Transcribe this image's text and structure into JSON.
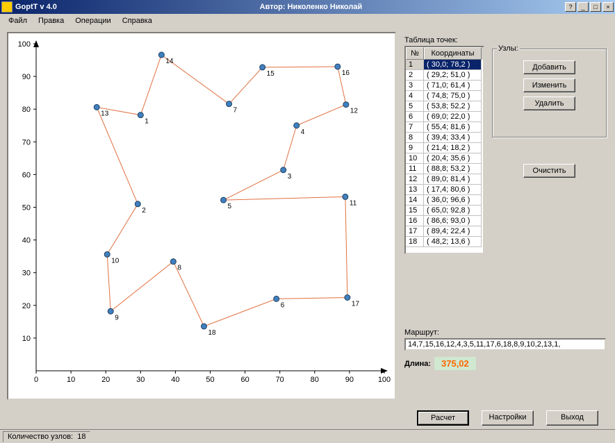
{
  "window": {
    "title_left": "GoptT v 4.0",
    "title_center": "Автор: Николенко Николай"
  },
  "menu": {
    "file": "Файл",
    "edit": "Правка",
    "ops": "Операции",
    "help": "Справка"
  },
  "labels": {
    "table": "Таблица точек:",
    "nodes_group": "Узлы:",
    "route": "Маршрут:",
    "length": "Длина:"
  },
  "table": {
    "col_n": "№",
    "col_coord": "Координаты",
    "rows": [
      {
        "n": "1",
        "coord": "( 30,0; 78,2 )",
        "selected": true
      },
      {
        "n": "2",
        "coord": "( 29,2; 51,0 )"
      },
      {
        "n": "3",
        "coord": "( 71,0; 61,4 )"
      },
      {
        "n": "4",
        "coord": "( 74,8; 75,0 )"
      },
      {
        "n": "5",
        "coord": "( 53,8; 52,2 )"
      },
      {
        "n": "6",
        "coord": "( 69,0; 22,0 )"
      },
      {
        "n": "7",
        "coord": "( 55,4; 81,6 )"
      },
      {
        "n": "8",
        "coord": "( 39,4; 33,4 )"
      },
      {
        "n": "9",
        "coord": "( 21,4; 18,2 )"
      },
      {
        "n": "10",
        "coord": "( 20,4; 35,6 )"
      },
      {
        "n": "11",
        "coord": "( 88,8; 53,2 )"
      },
      {
        "n": "12",
        "coord": "( 89,0; 81,4 )"
      },
      {
        "n": "13",
        "coord": "( 17,4; 80,6 )"
      },
      {
        "n": "14",
        "coord": "( 36,0; 96,6 )"
      },
      {
        "n": "15",
        "coord": "( 65,0; 92,8 )"
      },
      {
        "n": "16",
        "coord": "( 86,6; 93,0 )"
      },
      {
        "n": "17",
        "coord": "( 89,4; 22,4 )"
      },
      {
        "n": "18",
        "coord": "( 48,2; 13,6 )"
      }
    ]
  },
  "buttons": {
    "add": "Добавить",
    "edit_btn": "Изменить",
    "delete": "Удалить",
    "clear": "Очистить",
    "calc": "Расчет",
    "settings": "Настройки",
    "exit": "Выход"
  },
  "route": "14,7,15,16,12,4,3,5,11,17,6,18,8,9,10,2,13,1,",
  "length": "375,02",
  "status": {
    "count_label": "Количество узлов:",
    "count_value": "18"
  },
  "chart_data": {
    "type": "scatter",
    "xlabel": "",
    "ylabel": "",
    "xlim": [
      0,
      100
    ],
    "ylim": [
      0,
      100
    ],
    "xticks": [
      0,
      10,
      20,
      30,
      40,
      50,
      60,
      70,
      80,
      90,
      100
    ],
    "yticks": [
      10,
      20,
      30,
      40,
      50,
      60,
      70,
      80,
      90,
      100
    ],
    "points": [
      {
        "id": 1,
        "x": 30.0,
        "y": 78.2
      },
      {
        "id": 2,
        "x": 29.2,
        "y": 51.0
      },
      {
        "id": 3,
        "x": 71.0,
        "y": 61.4
      },
      {
        "id": 4,
        "x": 74.8,
        "y": 75.0
      },
      {
        "id": 5,
        "x": 53.8,
        "y": 52.2
      },
      {
        "id": 6,
        "x": 69.0,
        "y": 22.0
      },
      {
        "id": 7,
        "x": 55.4,
        "y": 81.6
      },
      {
        "id": 8,
        "x": 39.4,
        "y": 33.4
      },
      {
        "id": 9,
        "x": 21.4,
        "y": 18.2
      },
      {
        "id": 10,
        "x": 20.4,
        "y": 35.6
      },
      {
        "id": 11,
        "x": 88.8,
        "y": 53.2
      },
      {
        "id": 12,
        "x": 89.0,
        "y": 81.4
      },
      {
        "id": 13,
        "x": 17.4,
        "y": 80.6
      },
      {
        "id": 14,
        "x": 36.0,
        "y": 96.6
      },
      {
        "id": 15,
        "x": 65.0,
        "y": 92.8
      },
      {
        "id": 16,
        "x": 86.6,
        "y": 93.0
      },
      {
        "id": 17,
        "x": 89.4,
        "y": 22.4
      },
      {
        "id": 18,
        "x": 48.2,
        "y": 13.6
      }
    ],
    "route": [
      14,
      7,
      15,
      16,
      12,
      4,
      3,
      5,
      11,
      17,
      6,
      18,
      8,
      9,
      10,
      2,
      13,
      1
    ]
  }
}
